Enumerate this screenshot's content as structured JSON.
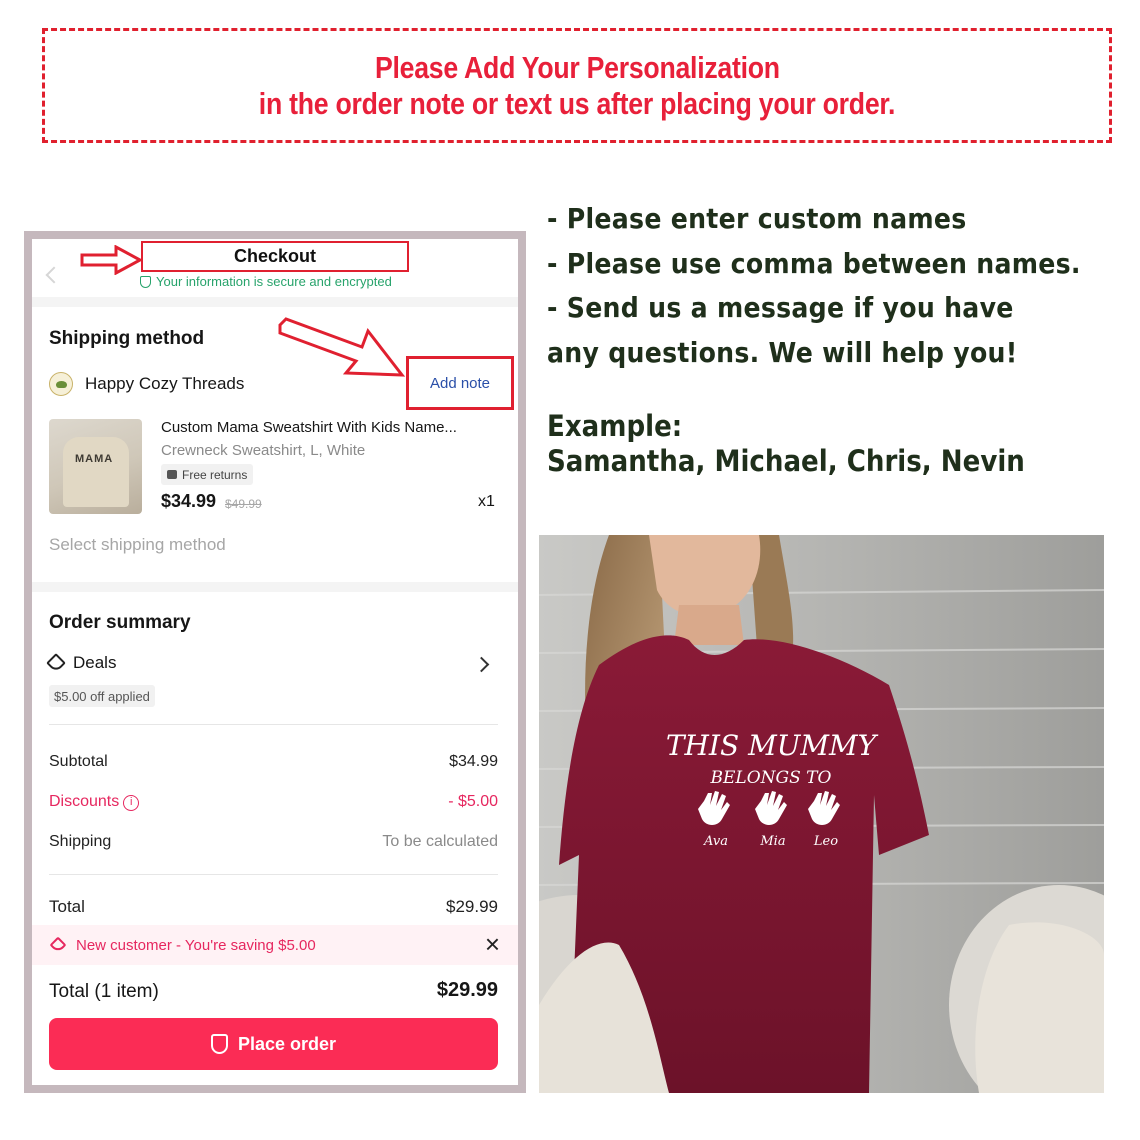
{
  "banner": {
    "line1": "Please Add Your Personalization",
    "line2": "in the order note or text us after placing your order."
  },
  "checkout": {
    "title": "Checkout",
    "secure_text": "Your information is secure and encrypted",
    "shipping_method_title": "Shipping method",
    "shop_name": "Happy Cozy Threads",
    "add_note": "Add note",
    "product": {
      "title": "Custom Mama Sweatshirt With Kids Name...",
      "variant": "Crewneck Sweatshirt, L, White",
      "badge": "Free returns",
      "price": "$34.99",
      "old_price": "$49.99",
      "qty": "x1",
      "thumb_text": "MAMA"
    },
    "select_shipping": "Select shipping method",
    "order_summary_title": "Order summary",
    "deals_label": "Deals",
    "deals_applied": "$5.00 off applied",
    "subtotal_label": "Subtotal",
    "subtotal_value": "$34.99",
    "discounts_label": "Discounts",
    "discounts_value": "- $5.00",
    "shipping_label": "Shipping",
    "shipping_value": "To be calculated",
    "total_label": "Total",
    "total_value": "$29.99",
    "saving_text": "New customer - You're saving $5.00",
    "total_items_label": "Total",
    "total_items_count": "(1 item)",
    "total_items_value": "$29.99",
    "place_order": "Place order"
  },
  "instructions": {
    "line1": "- Please enter custom names",
    "line2": "- Please use comma between names.",
    "line3": "- Send us a message if you have",
    "line4": "any questions. We will help you!"
  },
  "example": {
    "label": "Example:",
    "names": "Samantha, Michael, Chris, Nevin"
  },
  "shirt": {
    "line1": "THIS MUMMY",
    "line2": "BELONGS TO",
    "names": [
      "Ava",
      "Mia",
      "Leo"
    ]
  },
  "colors": {
    "banner_red": "#e8203a",
    "place_order": "#fb2c55",
    "secure_green": "#27a36b",
    "link_blue": "#2a4fa8",
    "instruction_text": "#1f2f1b",
    "shirt_maroon": "#7a1530"
  }
}
